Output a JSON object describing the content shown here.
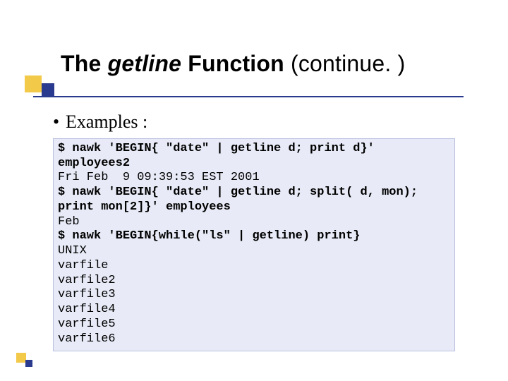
{
  "title": {
    "the": "The ",
    "fn": "getline",
    "func_word": " Function ",
    "continue": "(continue. )"
  },
  "bullet": {
    "dot": "•",
    "text": "Examples :"
  },
  "code": {
    "cmd1": "$ nawk 'BEGIN{ \"date\" | getline d; print d}' employees2",
    "out1": "Fri Feb  9 09:39:53 EST 2001",
    "cmd2": "$ nawk 'BEGIN{ \"date\" | getline d; split( d, mon); print mon[2]}' employees",
    "out2": "Feb",
    "cmd3": "$ nawk 'BEGIN{while(\"ls\" | getline) print}",
    "out3a": "UNIX",
    "out3b": "varfile",
    "out3c": "varfile2",
    "out3d": "varfile3",
    "out3e": "varfile4",
    "out3f": "varfile5",
    "out3g": "varfile6"
  }
}
